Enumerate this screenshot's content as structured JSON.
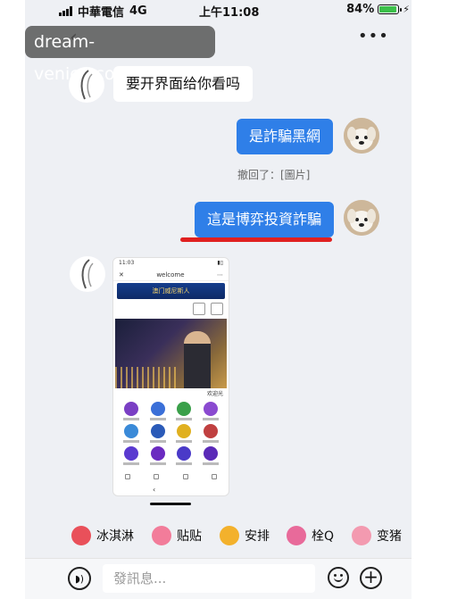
{
  "status_bar": {
    "carrier": "中華電信",
    "network": "4G",
    "time": "上午11:08",
    "battery": "84%",
    "battery_level": 0.84
  },
  "header": {
    "back_icon": "chevron-left-icon",
    "more_icon": "ellipsis-icon",
    "watermark": "dream-venice.com.cn"
  },
  "messages": [
    {
      "side": "in",
      "text": "要开界面给你看吗"
    },
    {
      "side": "out",
      "text": "是詐騙黑網"
    },
    {
      "side": "system",
      "text": "撤回了：[圖片]"
    },
    {
      "side": "out",
      "text": "這是博弈投資詐騙"
    },
    {
      "side": "in",
      "type": "image"
    }
  ],
  "screenshot_image": {
    "time": "11:03",
    "title": "welcome",
    "banner": "澳门威尼斯人",
    "welcome_text": "欢迎光"
  },
  "stickers": [
    {
      "label": "冰淇淋",
      "color": "#e9505a"
    },
    {
      "label": "贴贴",
      "color": "#f27c9a"
    },
    {
      "label": "安排",
      "color": "#f3b12c"
    },
    {
      "label": "栓Q",
      "color": "#e86a9a"
    },
    {
      "label": "变猪",
      "color": "#f39ab0"
    }
  ],
  "input_bar": {
    "placeholder": "發訊息...",
    "voice_icon": "voice-icon",
    "emoji_icon": "emoji-icon",
    "plus_icon": "plus-icon"
  },
  "colors": {
    "outgoing_bubble": "#2f7fe8",
    "incoming_bubble": "#ffffff",
    "highlight_underline": "#e02020",
    "chat_background": "#eef0f4"
  }
}
